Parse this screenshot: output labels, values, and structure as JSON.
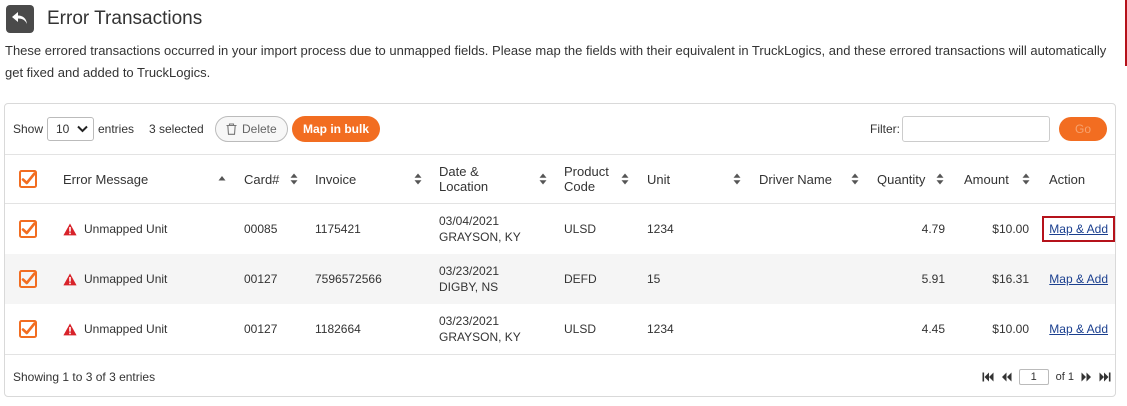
{
  "page": {
    "title": "Error Transactions",
    "description": "These errored transactions occurred in your import process due to unmapped fields. Please map the fields with their equivalent in TruckLogics, and these errored transactions will automatically get fixed and added to TruckLogics."
  },
  "toolbar": {
    "show_label": "Show",
    "entries_value": "10",
    "entries_label": "entries",
    "selected_count": "3 selected",
    "delete_label": "Delete",
    "bulk_label": "Map in bulk",
    "filter_label": "Filter:",
    "filter_value": "",
    "go_label": "Go"
  },
  "table": {
    "headers": {
      "error": "Error Message",
      "card": "Card#",
      "invoice": "Invoice",
      "date": "Date &",
      "location": "Location",
      "product": "Product",
      "code": "Code",
      "unit": "Unit",
      "driver": "Driver Name",
      "quantity": "Quantity",
      "amount": "Amount",
      "action": "Action"
    },
    "rows": [
      {
        "error": "Unmapped Unit",
        "card": "00085",
        "invoice": "1175421",
        "date": "03/04/2021",
        "location": "GRAYSON, KY",
        "product": "ULSD",
        "unit": "1234",
        "driver": "",
        "quantity": "4.79",
        "amount": "$10.00",
        "action": "Map & Add"
      },
      {
        "error": "Unmapped Unit",
        "card": "00127",
        "invoice": "7596572566",
        "date": "03/23/2021",
        "location": "DIGBY, NS",
        "product": "DEFD",
        "unit": "15",
        "driver": "",
        "quantity": "5.91",
        "amount": "$16.31",
        "action": "Map & Add"
      },
      {
        "error": "Unmapped Unit",
        "card": "00127",
        "invoice": "1182664",
        "date": "03/23/2021",
        "location": "GRAYSON, KY",
        "product": "ULSD",
        "unit": "1234",
        "driver": "",
        "quantity": "4.45",
        "amount": "$10.00",
        "action": "Map & Add"
      }
    ]
  },
  "footer": {
    "showing_text": "Showing 1 to 3 of 3 entries",
    "page_value": "1",
    "of_label": "of 1"
  },
  "colors": {
    "accent": "#f26d21",
    "error_icon": "#d8232a",
    "link": "#1a3f8f",
    "highlight": "#b5121b"
  },
  "icons": {
    "back": "back-arrow-icon",
    "error": "warning-triangle-icon",
    "delete": "trash-icon",
    "sort": "sort-arrows-icon",
    "pager": [
      "first-page-icon",
      "prev-page-icon",
      "next-page-icon",
      "last-page-icon"
    ]
  }
}
